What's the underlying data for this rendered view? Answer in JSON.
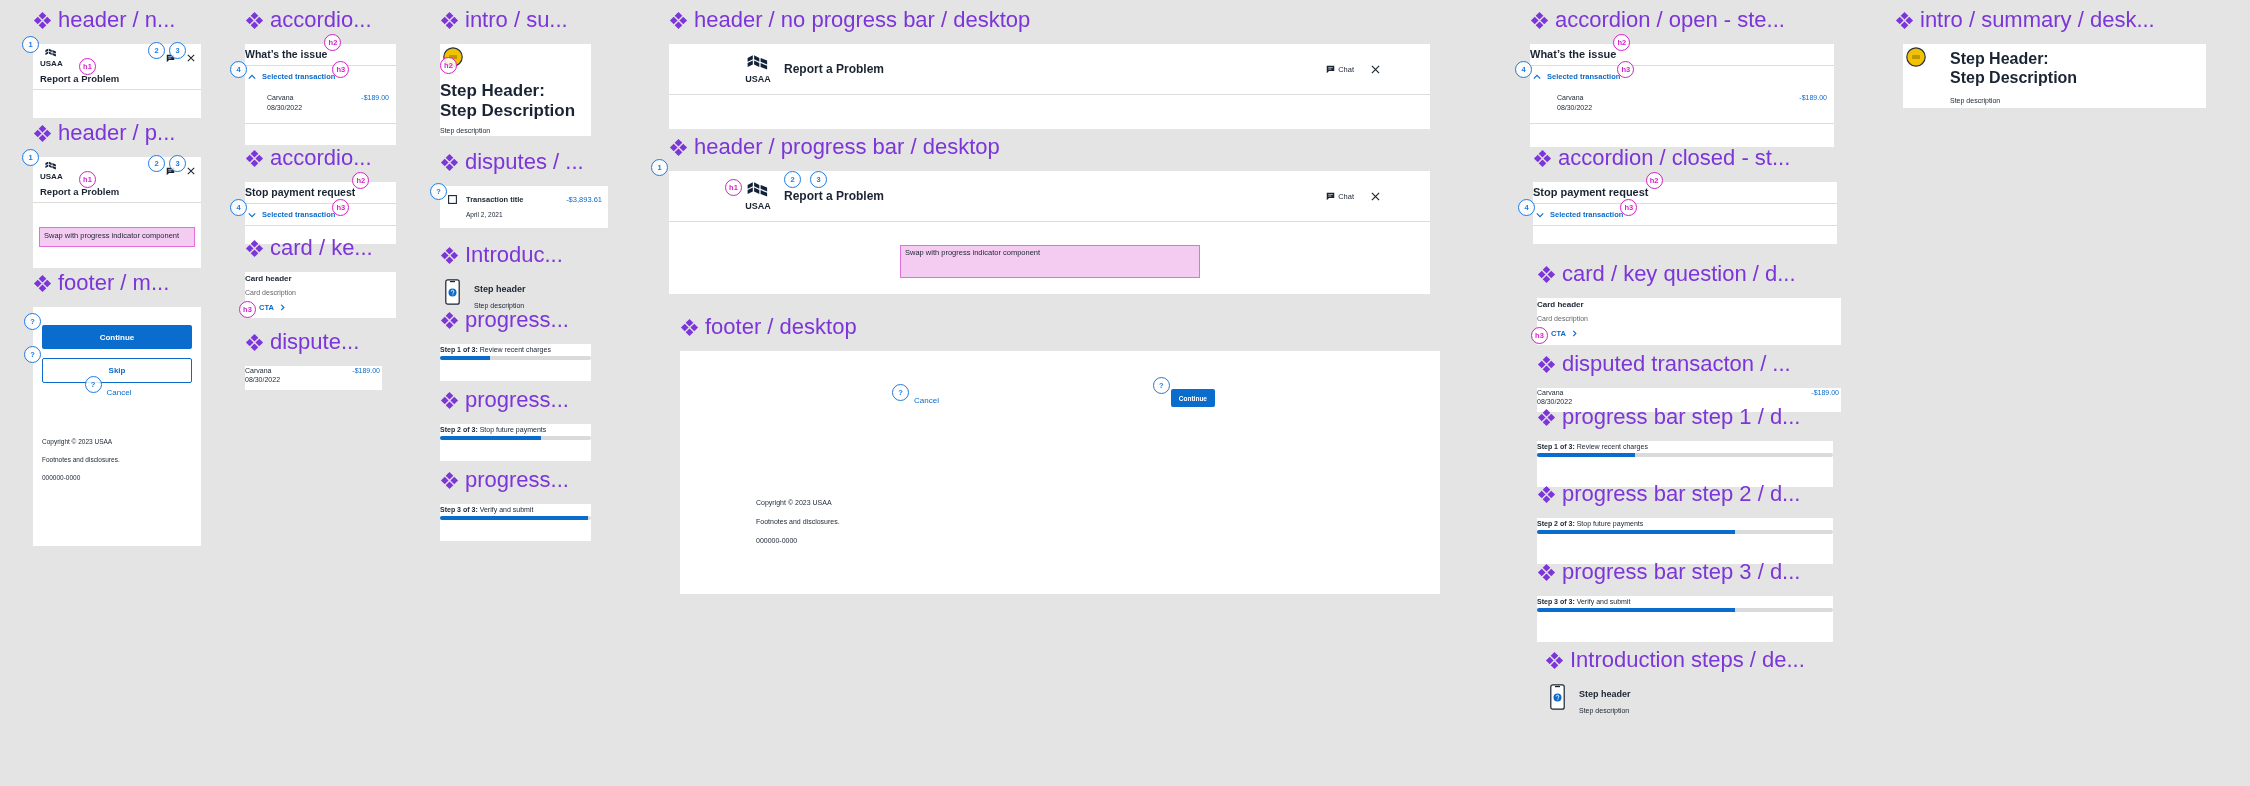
{
  "frames": [
    {
      "kind": "header-mobile",
      "label": "header / n...",
      "logo": {
        "text": "USAA",
        "markers": [
          {
            "kind": "number",
            "text": "1"
          }
        ]
      },
      "title": {
        "text": "Report a Problem",
        "markers": [
          {
            "kind": "heading",
            "text": "h1"
          }
        ]
      },
      "chat": {
        "markers": [
          {
            "kind": "number",
            "text": "2"
          }
        ]
      },
      "close": {
        "markers": [
          {
            "kind": "number",
            "text": "3"
          }
        ]
      }
    },
    {
      "kind": "header-mobile",
      "label": "header / p...",
      "logo": {
        "text": "USAA",
        "markers": [
          {
            "kind": "number",
            "text": "1"
          }
        ]
      },
      "title": {
        "text": "Report a Problem",
        "markers": [
          {
            "kind": "heading",
            "text": "h1"
          }
        ]
      },
      "chat": {
        "markers": [
          {
            "kind": "number",
            "text": "2"
          }
        ]
      },
      "close": {
        "markers": [
          {
            "kind": "number",
            "text": "3"
          }
        ]
      },
      "note": "Swap with progress indicator component"
    },
    {
      "kind": "footer-mobile",
      "label": "footer / m...",
      "buttons": [
        {
          "kind": "primary",
          "text": "Continue",
          "markers": [
            {
              "kind": "number",
              "text": "?"
            }
          ]
        },
        {
          "kind": "secondary",
          "text": "Skip",
          "markers": [
            {
              "kind": "number",
              "text": "?"
            }
          ]
        },
        {
          "kind": "link",
          "text": "Cancel",
          "markers": [
            {
              "kind": "number",
              "text": "?"
            }
          ]
        }
      ],
      "legal": [
        "Copyright © 2023 USAA",
        "Footnotes and disclosures.",
        "000000-0000"
      ]
    },
    {
      "kind": "accordion",
      "label": "accordio...",
      "title": {
        "text": "What’s the issue",
        "markers": [
          {
            "kind": "heading",
            "text": "h2"
          }
        ]
      },
      "toggle": {
        "text": "Selected transaction",
        "expanded": true,
        "markers": [
          {
            "kind": "number",
            "text": "4"
          },
          {
            "kind": "heading",
            "text": "h3"
          }
        ]
      },
      "transaction": {
        "merchant": "Carvana",
        "date": "08/30/2022",
        "amount": "-$189.00"
      }
    },
    {
      "kind": "accordion",
      "label": "accordio...",
      "title": {
        "text": "Stop payment request",
        "markers": [
          {
            "kind": "heading",
            "text": "h2"
          }
        ]
      },
      "toggle": {
        "text": "Selected transaction",
        "expanded": false,
        "markers": [
          {
            "kind": "number",
            "text": "4"
          },
          {
            "kind": "heading",
            "text": "h3"
          }
        ]
      }
    },
    {
      "kind": "card",
      "label": "card / ke...",
      "header": "Card header",
      "description": "Card description",
      "cta": {
        "text": "CTA",
        "markers": [
          {
            "kind": "heading",
            "text": "h3"
          }
        ]
      }
    },
    {
      "kind": "dispute",
      "label": "dispute...",
      "merchant": "Carvana",
      "date": "08/30/2022",
      "amount": "-$189.00"
    },
    {
      "kind": "intro-summary-mobile",
      "label": "intro / su...",
      "heading": {
        "lines": [
          "Step Header:",
          "Step Description"
        ],
        "markers": [
          {
            "kind": "heading",
            "text": "h2"
          }
        ]
      },
      "description": "Step description"
    },
    {
      "kind": "disputes-card",
      "label": "disputes / ...",
      "icon": {
        "markers": [
          {
            "kind": "number",
            "text": "?"
          }
        ]
      },
      "title": "Transaction title",
      "date": "April 2, 2021",
      "amount": "-$3,893.61"
    },
    {
      "kind": "intro-steps",
      "label": "Introduc...",
      "header": "Step header",
      "description": "Step description"
    },
    {
      "kind": "progress",
      "label": "progress...",
      "text": "**Step 1 of 3:** Review recent charges",
      "level": 0.33
    },
    {
      "kind": "progress",
      "label": "progress...",
      "text": "**Step 2 of 3:** Stop future payments",
      "level": 0.67
    },
    {
      "kind": "progress",
      "label": "progress...",
      "text": "**Step 3 of 3:** Verify and submit",
      "level": 0.98
    },
    {
      "kind": "header-desktop",
      "label": "header / no progress bar / desktop",
      "logo": {
        "text": "USAA"
      },
      "title": {
        "text": "Report a Problem"
      },
      "chat": {
        "text": "Chat"
      }
    },
    {
      "kind": "header-desktop",
      "label": "header / progress bar / desktop",
      "markers": [
        {
          "kind": "number",
          "text": "1"
        }
      ],
      "logo": {
        "text": "USAA",
        "markers": [
          {
            "kind": "heading",
            "text": "h1"
          }
        ]
      },
      "title": {
        "text": "Report a Problem",
        "markers": [
          {
            "kind": "number",
            "text": "2"
          },
          {
            "kind": "number",
            "text": "3"
          }
        ]
      },
      "chat": {
        "text": "Chat"
      },
      "note": "Swap with progress indicator component"
    },
    {
      "kind": "footer-desktop",
      "label": "footer / desktop",
      "buttons": [
        {
          "kind": "link",
          "text": "Cancel",
          "markers": [
            {
              "kind": "number",
              "text": "?"
            }
          ]
        },
        {
          "kind": "primary",
          "text": "Continue",
          "markers": [
            {
              "kind": "number",
              "text": "?"
            }
          ]
        }
      ],
      "legal": [
        "Copyright © 2023 USAA",
        "Footnotes and disclosures.",
        "000000-0000"
      ]
    },
    {
      "kind": "accordion",
      "label": "accordion / open - ste...",
      "title": {
        "text": "What’s the issue",
        "markers": [
          {
            "kind": "heading",
            "text": "h2"
          }
        ]
      },
      "toggle": {
        "text": "Selected transaction",
        "expanded": true,
        "markers": [
          {
            "kind": "number",
            "text": "4"
          },
          {
            "kind": "heading",
            "text": "h3"
          }
        ]
      },
      "transaction": {
        "merchant": "Carvana",
        "date": "08/30/2022",
        "amount": "-$189.00"
      }
    },
    {
      "kind": "accordion",
      "label": "accordion / closed - st...",
      "title": {
        "text": "Stop payment request",
        "markers": [
          {
            "kind": "heading",
            "text": "h2"
          }
        ]
      },
      "toggle": {
        "text": "Selected transaction",
        "expanded": false,
        "markers": [
          {
            "kind": "number",
            "text": "4"
          },
          {
            "kind": "heading",
            "text": "h3"
          }
        ]
      }
    },
    {
      "kind": "card",
      "label": "card / key question / d...",
      "header": "Card header",
      "description": "Card description",
      "cta": {
        "text": "CTA",
        "markers": [
          {
            "kind": "heading",
            "text": "h3"
          }
        ]
      }
    },
    {
      "kind": "dispute",
      "label": "disputed transacton / ...",
      "merchant": "Carvana",
      "date": "08/30/2022",
      "amount": "-$189.00"
    },
    {
      "kind": "progress",
      "label": "progress bar step 1 / d...",
      "text": "**Step 1 of 3:** Review recent charges",
      "level": 0.33
    },
    {
      "kind": "progress",
      "label": "progress bar step 2 / d...",
      "text": "**Step 2 of 3:** Stop future payments",
      "level": 0.67
    },
    {
      "kind": "progress",
      "label": "progress bar step 3 / d...",
      "text": "**Step 3 of 3:** Verify and submit",
      "level": 0.67
    },
    {
      "kind": "intro-steps",
      "label": "Introduction steps / de...",
      "header": "Step header",
      "description": "Step description"
    },
    {
      "kind": "intro-summary-desktop",
      "label": "intro / summary / desk...",
      "heading": {
        "lines": [
          "Step Header:",
          "Step Description"
        ]
      },
      "description": "Step description"
    }
  ]
}
